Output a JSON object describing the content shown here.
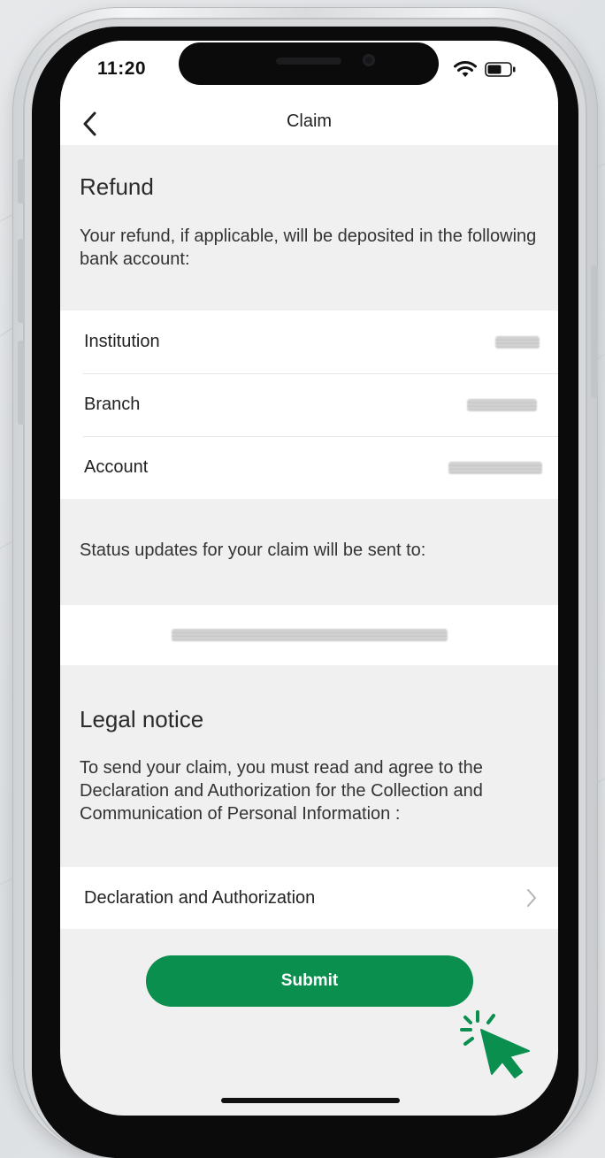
{
  "status_bar": {
    "time": "11:20"
  },
  "nav": {
    "title": "Claim"
  },
  "refund": {
    "title": "Refund",
    "description": "Your refund, if applicable, will be deposited in the following bank account:",
    "rows": [
      {
        "label": "Institution"
      },
      {
        "label": "Branch"
      },
      {
        "label": "Account"
      }
    ]
  },
  "status_updates": {
    "description": "Status updates for your claim will be sent to:"
  },
  "legal": {
    "title": "Legal notice",
    "description": "To send your claim, you must read and agree to the Declaration and Authorization for the Collection and Communication of Personal Information :",
    "link_label": "Declaration and Authorization"
  },
  "actions": {
    "submit_label": "Submit"
  },
  "colors": {
    "accent": "#0a8f4f",
    "background": "#f0f0f0",
    "card": "#ffffff"
  },
  "icons": [
    "back-chevron-icon",
    "wifi-icon",
    "battery-icon",
    "chevron-right-icon",
    "pointer-cursor-icon"
  ]
}
